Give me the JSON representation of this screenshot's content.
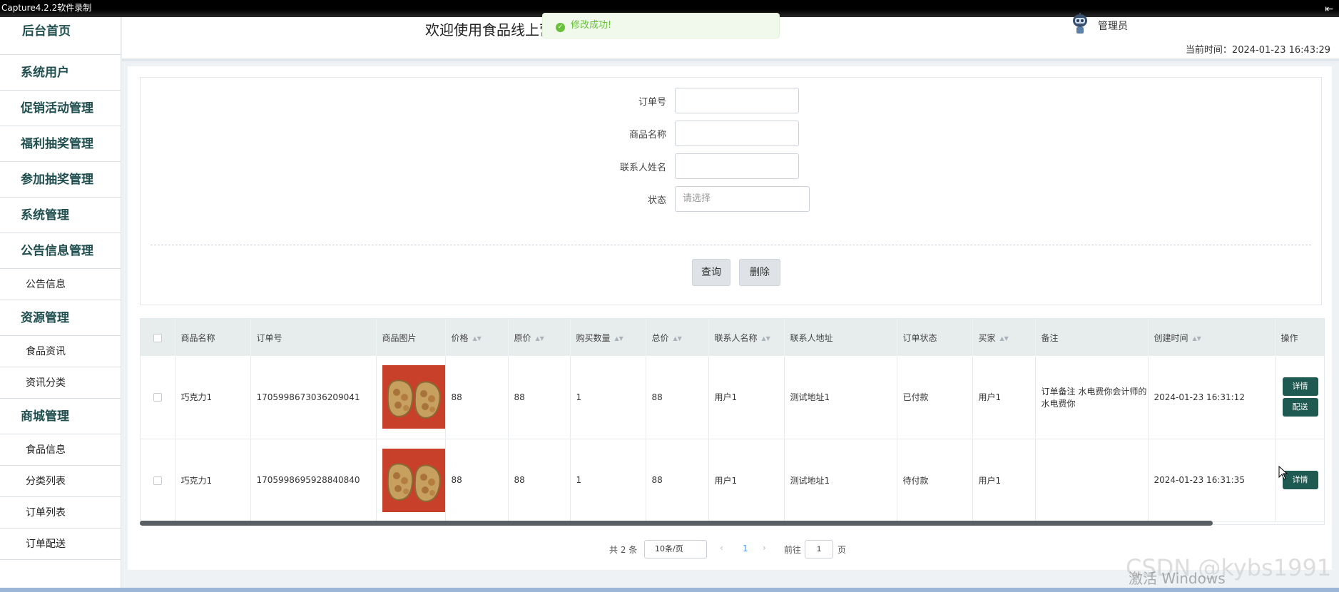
{
  "capture_bar": {
    "title": "Capture4.2.2软件录制"
  },
  "sidebar": {
    "items": [
      {
        "label": "后台首页",
        "level": "home"
      },
      {
        "label": "系统用户",
        "level": "top"
      },
      {
        "label": "促销活动管理",
        "level": "top"
      },
      {
        "label": "福利抽奖管理",
        "level": "top"
      },
      {
        "label": "参加抽奖管理",
        "level": "top"
      },
      {
        "label": "系统管理",
        "level": "top"
      },
      {
        "label": "公告信息管理",
        "level": "top"
      },
      {
        "label": "公告信息",
        "level": "sub"
      },
      {
        "label": "资源管理",
        "level": "top"
      },
      {
        "label": "食品资讯",
        "level": "sub"
      },
      {
        "label": "资讯分类",
        "level": "sub"
      },
      {
        "label": "商城管理",
        "level": "top"
      },
      {
        "label": "食品信息",
        "level": "sub"
      },
      {
        "label": "分类列表",
        "level": "sub"
      },
      {
        "label": "订单列表",
        "level": "sub"
      },
      {
        "label": "订单配送",
        "level": "sub"
      }
    ]
  },
  "header": {
    "welcome": "欢迎使用食品线上营",
    "toast": "修改成功!",
    "user": "管理员",
    "clock": "当前时间：2024-01-23 16:43:29"
  },
  "search": {
    "fields": [
      {
        "label": "订单号",
        "value": ""
      },
      {
        "label": "商品名称",
        "value": ""
      },
      {
        "label": "联系人姓名",
        "value": ""
      }
    ],
    "status_label": "状态",
    "status_placeholder": "请选择",
    "query_button": "查询",
    "delete_button": "删除"
  },
  "table": {
    "columns": [
      "商品名称",
      "订单号",
      "商品图片",
      "价格",
      "原价",
      "购买数量",
      "总价",
      "联系人名称",
      "联系人地址",
      "订单状态",
      "买家",
      "备注",
      "创建时间",
      "操作"
    ],
    "sortable": [
      false,
      false,
      false,
      true,
      true,
      true,
      true,
      true,
      false,
      false,
      true,
      false,
      true,
      false
    ],
    "rows": [
      {
        "name": "巧克力1",
        "order_no": "1705998673036209041",
        "price": "88",
        "orig_price": "88",
        "qty": "1",
        "total": "88",
        "contact": "用户1",
        "address": "测试地址1",
        "status": "已付款",
        "buyer": "用户1",
        "note": "订单备注 水电费你会计师的 水电费你",
        "created": "2024-01-23 16:31:12",
        "actions": [
          "详情",
          "配送"
        ]
      },
      {
        "name": "巧克力1",
        "order_no": "1705998695928840840",
        "price": "88",
        "orig_price": "88",
        "qty": "1",
        "total": "88",
        "contact": "用户1",
        "address": "测试地址1",
        "status": "待付款",
        "buyer": "用户1",
        "note": "",
        "created": "2024-01-23 16:31:35",
        "actions": [
          "详情"
        ]
      }
    ]
  },
  "pagination": {
    "total": "共 2 条",
    "page_size": "10条/页",
    "current_page": "1",
    "goto_prefix": "前往",
    "goto_value": "1",
    "goto_suffix": "页"
  },
  "watermark": {
    "csdn": "CSDN @kybs1991",
    "windows": "激活 Windows"
  },
  "colors": {
    "accent": "#1f5a52",
    "sidebar_text": "#1f4e4f",
    "success": "#67c23a",
    "page_link": "#409eff"
  }
}
